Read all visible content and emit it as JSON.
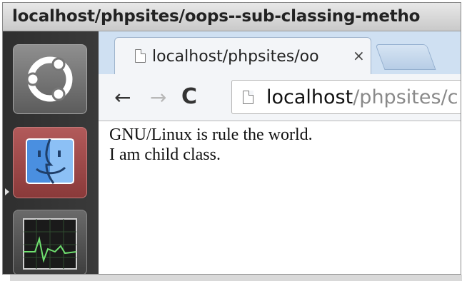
{
  "window": {
    "title": "localhost/phpsites/oops--sub-classing-metho"
  },
  "launcher": {
    "items": [
      {
        "name": "ubuntu-icon"
      },
      {
        "name": "finder-icon"
      },
      {
        "name": "system-monitor-icon"
      }
    ]
  },
  "tabs": [
    {
      "title": "localhost/phpsites/oo",
      "close": "×"
    }
  ],
  "toolbar": {
    "back": "←",
    "forward": "→",
    "reload": "C"
  },
  "omnibox": {
    "host": "localhost",
    "path": "/phpsites/c"
  },
  "page": {
    "lines": [
      "GNU/Linux is rule the world.",
      "I am child class."
    ]
  },
  "colors": {
    "tabstrip": "#cfe0f2",
    "toolbar": "#f3f5f8",
    "launcher": "#333333",
    "finder_tile": "#9a4848"
  }
}
